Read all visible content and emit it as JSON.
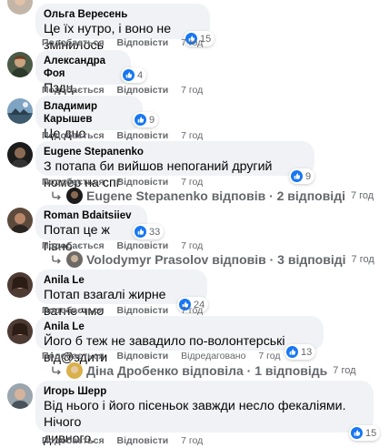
{
  "labels": {
    "like": "Подобається",
    "reply": "Відповісти",
    "edited": "Відредаговано"
  },
  "comments": [
    {
      "author": "Ольга Вересень",
      "text": "Це їх нутро, і воно не змінилось",
      "time": "7 год",
      "reactions": "15"
    },
    {
      "author": "Александра Фоя",
      "text": "Пздц.",
      "time": "7 год",
      "reactions": "4"
    },
    {
      "author": "Владимир Карышев",
      "text": "Це дно",
      "time": "7 год",
      "reactions": "9"
    },
    {
      "author": "Eugene Stepanenko",
      "text": "З потапа би вийшов непоганий другий номер на спг",
      "time": "7 год",
      "reactions": "9",
      "replies": {
        "label": "Eugene Stepanenko відповів · 2 відповіді",
        "time": "7 год"
      }
    },
    {
      "author": "Roman Bdaitsiiev",
      "text": "Потап це ж гівно",
      "time": "7 год",
      "reactions": "33",
      "replies": {
        "label": "Volodymyr Prasolov відповів · 3 відповіді",
        "time": "7 год"
      }
    },
    {
      "author": "Anila Le",
      "text": "Потап взагалі жирне ватне чмо",
      "time": "7 год",
      "reactions": "24"
    },
    {
      "author": "Anila Le",
      "text": "Його б теж не завадило по-волонтерські від@здити",
      "time": "7 год",
      "reactions": "13",
      "replies": {
        "label": "Діна Дробенко відповіла · 1 відповідь",
        "time": "7 год"
      }
    },
    {
      "author": "Игорь Шерр",
      "text_line1": "Від нього і його пісеньок завжди несло фекаліями. Нічого",
      "text_line2": "дивного.",
      "time": "7 год",
      "reactions": "15"
    }
  ],
  "colors": {
    "bubble": "#f0f2f5",
    "like_blue": "#1877f2",
    "meta_grey": "#65676b"
  },
  "icons": [
    "like-icon",
    "reply-arrow-icon"
  ]
}
